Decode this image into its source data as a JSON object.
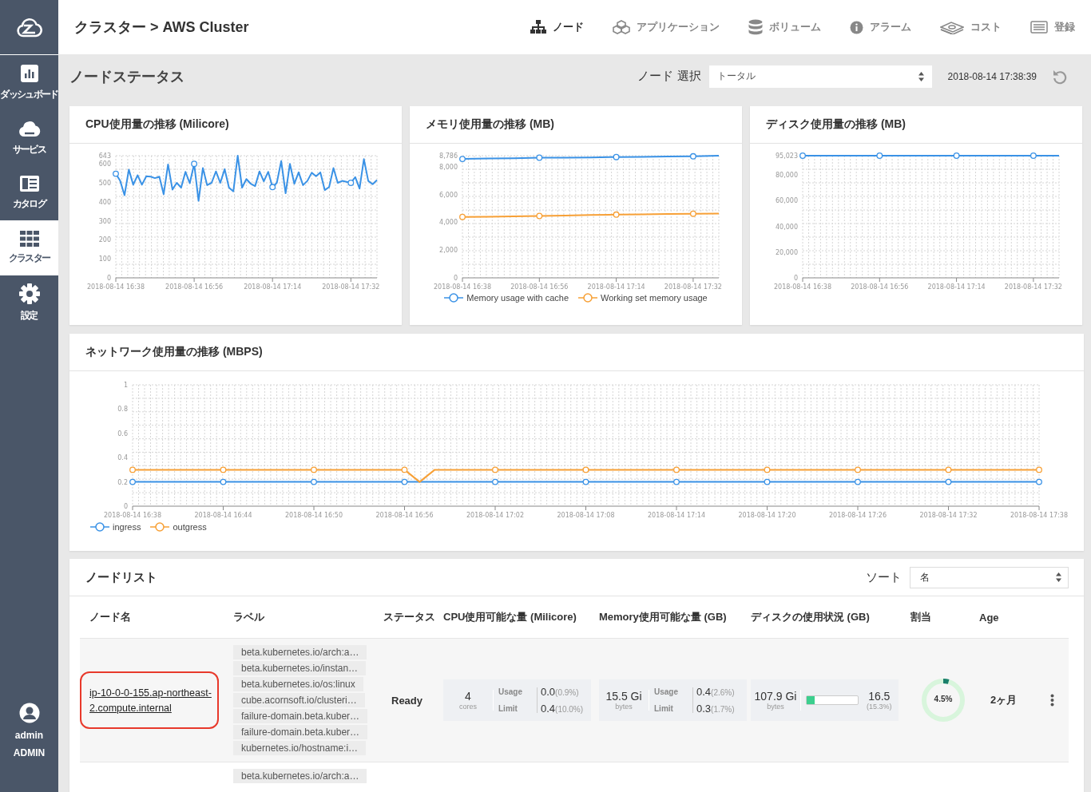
{
  "sidebar": {
    "items": [
      {
        "label": "ダッシュボード",
        "selected": false
      },
      {
        "label": "サービス",
        "selected": false
      },
      {
        "label": "カタログ",
        "selected": false
      },
      {
        "label": "クラスター",
        "selected": true
      },
      {
        "label": "設定",
        "selected": false
      }
    ],
    "user": {
      "name": "admin",
      "role": "ADMIN"
    }
  },
  "header": {
    "breadcrumb": "クラスター > AWS Cluster",
    "nav": [
      {
        "label": "ノード",
        "selected": true
      },
      {
        "label": "アプリケーション",
        "selected": false
      },
      {
        "label": "ボリューム",
        "selected": false
      },
      {
        "label": "アラーム",
        "selected": false
      },
      {
        "label": "コスト",
        "selected": false
      },
      {
        "label": "登録",
        "selected": false
      }
    ]
  },
  "toolbar": {
    "title": "ノードステータス",
    "node_select": {
      "label": "ノード 選択",
      "value": "トータル"
    },
    "timestamp": "2018-08-14 17:38:39"
  },
  "charts": [
    {
      "chart_data": {
        "type": "line",
        "title": "CPU使用量の推移 (Milicore)",
        "grid": true,
        "ylim": [
          0,
          643
        ],
        "categories": [
          "2018-08-14 16:38",
          null,
          null,
          null,
          null,
          null,
          null,
          null,
          null,
          null,
          null,
          null,
          null,
          null,
          null,
          null,
          null,
          null,
          "2018-08-14 16:56",
          null,
          null,
          null,
          null,
          null,
          null,
          null,
          null,
          null,
          null,
          null,
          null,
          null,
          null,
          null,
          null,
          null,
          "2018-08-14 17:14",
          null,
          null,
          null,
          null,
          null,
          null,
          null,
          null,
          null,
          null,
          null,
          null,
          null,
          null,
          null,
          null,
          null,
          "2018-08-14 17:32",
          null,
          null,
          null,
          null,
          null,
          null
        ],
        "yticks": [
          0,
          100,
          200,
          300,
          400,
          500,
          600,
          {
            "value": 643,
            "label": "643"
          }
        ],
        "series": [
          {
            "color": "#3a92e6",
            "values": [
              548,
              510,
              435,
              570,
              490,
              540,
              490,
              535,
              533,
              525,
              533,
              440,
              597,
              465,
              500,
              475,
              558,
              498,
              600,
              405,
              578,
              488,
              500,
              560,
              500,
              572,
              475,
              455,
              643,
              475,
              520,
              495,
              483,
              560,
              508,
              558,
              478,
              500,
              615,
              445,
              600,
              495,
              555,
              488,
              510,
              553,
              535,
              555,
              462,
              478,
              578,
              500,
              510,
              505,
              500,
              530,
              470,
              625,
              510,
              493,
              515
            ]
          }
        ]
      }
    },
    {
      "chart_data": {
        "type": "line",
        "title": "メモリ使用量の推移 (MB)",
        "grid": true,
        "legend": "bottom",
        "ylim": [
          0,
          8786
        ],
        "categories": [
          "2018-08-14 16:38",
          null,
          null,
          "2018-08-14 16:56",
          null,
          null,
          "2018-08-14 17:14",
          null,
          null,
          "2018-08-14 17:32",
          null
        ],
        "yticks": [
          0,
          {
            "value": 2000,
            "label": "2,000"
          },
          {
            "value": 4000,
            "label": "4,000"
          },
          {
            "value": 6000,
            "label": "6,000"
          },
          {
            "value": 8000,
            "label": "8,000"
          },
          {
            "value": 8786,
            "label": "8,786"
          }
        ],
        "series": [
          {
            "name": "Memory usage with cache",
            "color": "#3a92e6",
            "values": [
              8550,
              8580,
              8600,
              8640,
              8650,
              8660,
              8690,
              8700,
              8720,
              8740,
              8786
            ]
          },
          {
            "name": "Working set memory usage",
            "color": "#f7a036",
            "values": [
              4380,
              4400,
              4420,
              4450,
              4480,
              4520,
              4550,
              4570,
              4590,
              4610,
              4630
            ]
          }
        ]
      }
    },
    {
      "chart_data": {
        "type": "line",
        "title": "ディスク使用量の推移 (MB)",
        "grid": true,
        "ylim": [
          0,
          95023
        ],
        "categories": [
          "2018-08-14 16:38",
          null,
          null,
          "2018-08-14 16:56",
          null,
          null,
          "2018-08-14 17:14",
          null,
          null,
          "2018-08-14 17:32",
          null
        ],
        "yticks": [
          0,
          {
            "value": 20000,
            "label": "20,000"
          },
          {
            "value": 40000,
            "label": "40,000"
          },
          {
            "value": 60000,
            "label": "60,000"
          },
          {
            "value": 80000,
            "label": "80,000"
          },
          {
            "value": 95023,
            "label": "95,023"
          }
        ],
        "series": [
          {
            "color": "#3a92e6",
            "values": [
              95023,
              95023,
              95023,
              95023,
              95023,
              95023,
              95023,
              95023,
              95023,
              95023,
              95023
            ]
          }
        ]
      }
    },
    {
      "chart_data": {
        "type": "line",
        "title": "ネットワーク使用量の推移 (MBPS)",
        "grid": true,
        "legend": "bottom-left",
        "ylim": [
          0,
          1
        ],
        "categories": [
          "2018-08-14 16:38",
          null,
          null,
          null,
          null,
          null,
          "2018-08-14 16:44",
          null,
          null,
          null,
          null,
          null,
          "2018-08-14 16:50",
          null,
          null,
          null,
          null,
          null,
          "2018-08-14 16:56",
          null,
          null,
          null,
          null,
          null,
          "2018-08-14 17:02",
          null,
          null,
          null,
          null,
          null,
          "2018-08-14 17:08",
          null,
          null,
          null,
          null,
          null,
          "2018-08-14 17:14",
          null,
          null,
          null,
          null,
          null,
          "2018-08-14 17:20",
          null,
          null,
          null,
          null,
          null,
          "2018-08-14 17:26",
          null,
          null,
          null,
          null,
          null,
          "2018-08-14 17:32",
          null,
          null,
          null,
          null,
          null,
          "2018-08-14 17:38"
        ],
        "yticks": [
          0,
          0.2,
          0.4,
          0.6,
          0.8,
          1
        ],
        "series": [
          {
            "name": "ingress",
            "color": "#3a92e6",
            "values": [
              0.2,
              0.2,
              0.2,
              0.2,
              0.2,
              0.2,
              0.2,
              0.2,
              0.2,
              0.2,
              0.2,
              0.2,
              0.2,
              0.2,
              0.2,
              0.2,
              0.2,
              0.2,
              0.2,
              0.2,
              0.2,
              0.2,
              0.2,
              0.2,
              0.2,
              0.2,
              0.2,
              0.2,
              0.2,
              0.2,
              0.2,
              0.2,
              0.2,
              0.2,
              0.2,
              0.2,
              0.2,
              0.2,
              0.2,
              0.2,
              0.2,
              0.2,
              0.2,
              0.2,
              0.2,
              0.2,
              0.2,
              0.2,
              0.2,
              0.2,
              0.2,
              0.2,
              0.2,
              0.2,
              0.2,
              0.2,
              0.2,
              0.2,
              0.2,
              0.2,
              0.2
            ]
          },
          {
            "name": "outgress",
            "color": "#f7a036",
            "values": [
              0.3,
              0.3,
              0.3,
              0.3,
              0.3,
              0.3,
              0.3,
              0.3,
              0.3,
              0.3,
              0.3,
              0.3,
              0.3,
              0.3,
              0.3,
              0.3,
              0.3,
              0.3,
              0.3,
              0.2,
              0.3,
              0.3,
              0.3,
              0.3,
              0.3,
              0.3,
              0.3,
              0.3,
              0.3,
              0.3,
              0.3,
              0.3,
              0.3,
              0.3,
              0.3,
              0.3,
              0.3,
              0.3,
              0.3,
              0.3,
              0.3,
              0.3,
              0.3,
              0.3,
              0.3,
              0.3,
              0.3,
              0.3,
              0.3,
              0.3,
              0.3,
              0.3,
              0.3,
              0.3,
              0.3,
              0.3,
              0.3,
              0.3,
              0.3,
              0.3,
              0.3
            ]
          }
        ]
      }
    }
  ],
  "node_list": {
    "title": "ノードリスト",
    "sort": {
      "label": "ソート",
      "value": "名"
    },
    "columns": [
      "ノード名",
      "ラベル",
      "ステータス",
      "CPU使用可能な量 (Milicore)",
      "Memory使用可能な量 (GB)",
      "ディスクの使用状況 (GB)",
      "割当",
      "Age"
    ],
    "rows": [
      {
        "highlighted": true,
        "name": "ip-10-0-0-155.ap-northeast-2.compute.internal",
        "labels": [
          "beta.kubernetes.io/arch:a…",
          "beta.kubernetes.io/instan…",
          "beta.kubernetes.io/os:linux",
          "cube.acornsoft.io/clusteri…",
          "failure-domain.beta.kuber…",
          "failure-domain.beta.kuber…",
          "kubernetes.io/hostname:i…"
        ],
        "status": "Ready",
        "cpu": {
          "total": "4",
          "unit": "cores",
          "usage_label": "Usage",
          "usage": "0.0",
          "usage_pct": "(0.9%)",
          "limit_label": "Limit",
          "limit": "0.4",
          "limit_pct": "(10.0%)"
        },
        "memory": {
          "total": "15.5 Gi",
          "unit": "bytes",
          "usage_label": "Usage",
          "usage": "0.4",
          "usage_pct": "(2.6%)",
          "limit_label": "Limit",
          "limit": "0.3",
          "limit_pct": "(1.7%)"
        },
        "disk": {
          "total": "107.9 Gi",
          "unit": "bytes",
          "level": 0.153,
          "used": "16.5",
          "used_pct": "(15.3%)"
        },
        "allocation": {
          "level": 0.045,
          "reading": "4.5%"
        },
        "age": "2ヶ月"
      },
      {
        "highlighted": false,
        "labels": [
          "beta.kubernetes.io/arch:a…"
        ]
      }
    ]
  }
}
